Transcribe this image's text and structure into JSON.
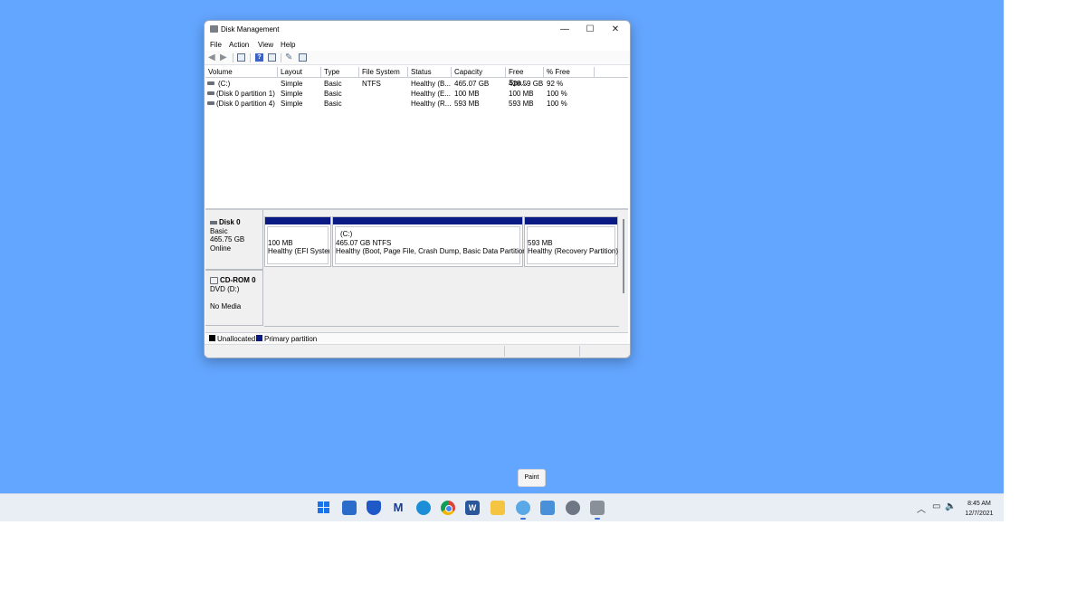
{
  "window": {
    "title": "Disk Management",
    "controls": {
      "minimize": "—",
      "maximize": "☐",
      "close": "✕"
    },
    "menu": [
      "File",
      "Action",
      "View",
      "Help"
    ]
  },
  "toolbar": {
    "back": "back-arrow-icon",
    "forward": "forward-arrow-icon",
    "icons": [
      "console-tree-icon",
      "help-icon",
      "properties-icon",
      "rescan-icon",
      "settings-icon"
    ]
  },
  "volume_list": {
    "columns": [
      "Volume",
      "Layout",
      "Type",
      "File System",
      "Status",
      "Capacity",
      "Free Spa...",
      "% Free"
    ],
    "rows": [
      {
        "volume": "(C:)",
        "layout": "Simple",
        "type": "Basic",
        "fs": "NTFS",
        "status": "Healthy (B...",
        "capacity": "465.07 GB",
        "free": "428.59 GB",
        "pct": "92 %"
      },
      {
        "volume": "(Disk 0 partition 1)",
        "layout": "Simple",
        "type": "Basic",
        "fs": "",
        "status": "Healthy (E...",
        "capacity": "100 MB",
        "free": "100 MB",
        "pct": "100 %"
      },
      {
        "volume": "(Disk 0 partition 4)",
        "layout": "Simple",
        "type": "Basic",
        "fs": "",
        "status": "Healthy (R...",
        "capacity": "593 MB",
        "free": "593 MB",
        "pct": "100 %"
      }
    ]
  },
  "disks": {
    "disk0": {
      "name": "Disk 0",
      "type": "Basic",
      "size": "465.75 GB",
      "state": "Online",
      "partitions": [
        {
          "title": "",
          "size": "100 MB",
          "status": "Healthy (EFI System"
        },
        {
          "title": "(C:)",
          "size": "465.07 GB NTFS",
          "status": "Healthy (Boot, Page File, Crash Dump, Basic Data Partition)"
        },
        {
          "title": "",
          "size": "593 MB",
          "status": "Healthy (Recovery Partition)"
        }
      ]
    },
    "cdrom0": {
      "name": "CD-ROM 0",
      "type": "DVD (D:)",
      "media": "No Media"
    }
  },
  "legend": [
    {
      "label": "Unallocated",
      "color": "#000000"
    },
    {
      "label": "Primary partition",
      "color": "#0a1a84"
    }
  ],
  "colors": {
    "desktop": "#63a6ff",
    "partition_bar": "#0a1a84",
    "taskbar": "#e9eef5"
  },
  "tooltip": "Paint",
  "taskbar": {
    "apps": [
      "start-icon",
      "mail-icon",
      "defender-icon",
      "malwarebytes-icon",
      "edge-icon",
      "chrome-icon",
      "word-icon",
      "file-explorer-icon",
      "paint-icon",
      "photos-icon",
      "settings-icon",
      "disk-management-icon"
    ],
    "time": "8:45 AM",
    "date": "12/7/2021"
  }
}
